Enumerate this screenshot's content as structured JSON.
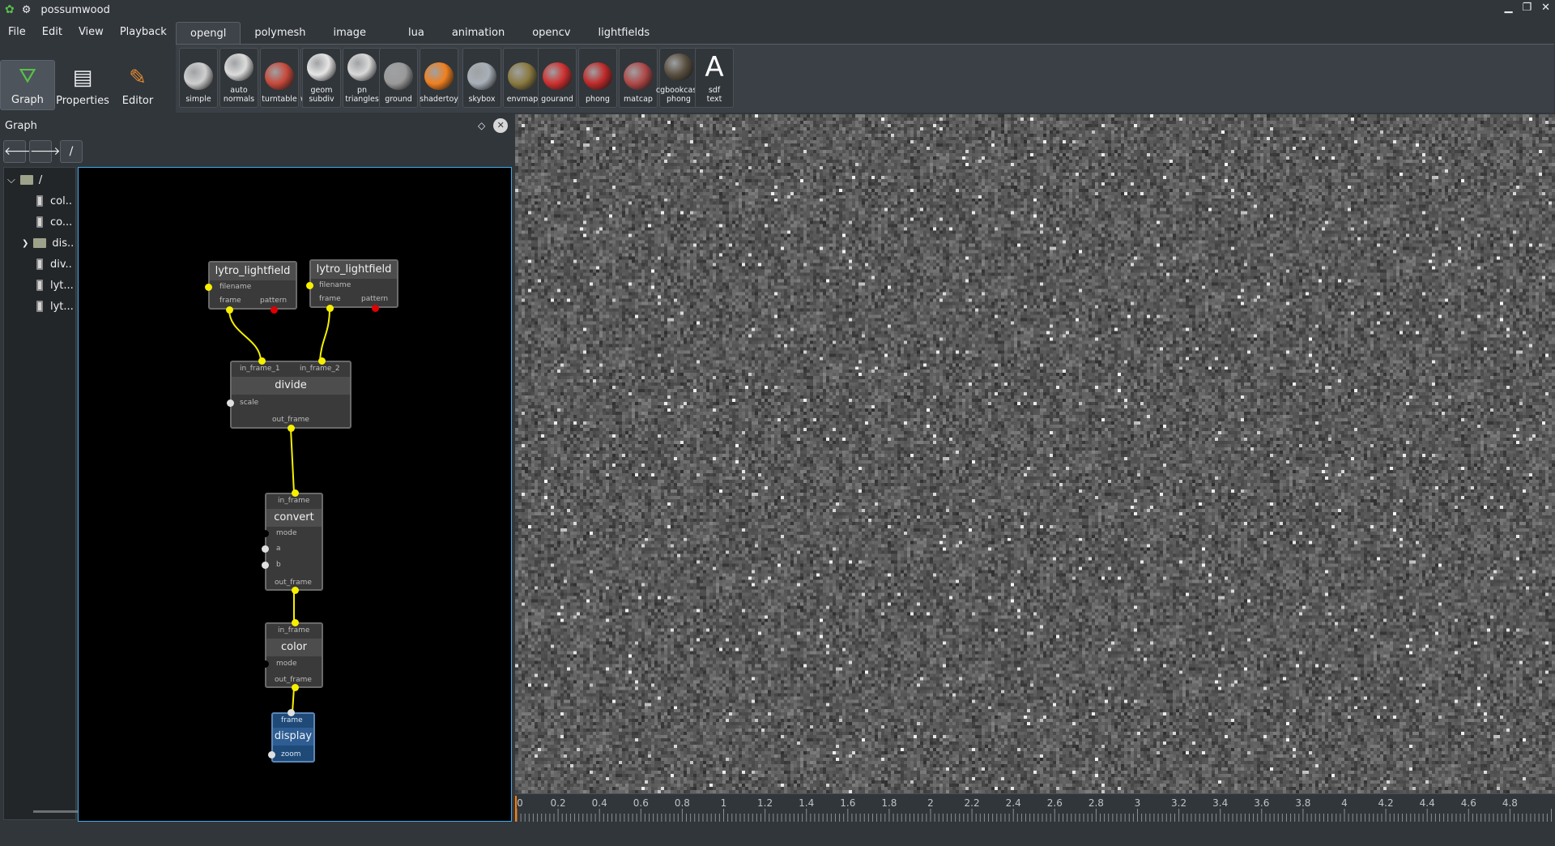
{
  "window": {
    "title": "possumwood",
    "controls": [
      "▁",
      "❐",
      "✕"
    ]
  },
  "menu": [
    "File",
    "Edit",
    "View",
    "Playback"
  ],
  "modes": [
    {
      "label": "Graph",
      "icon": "graph-icon"
    },
    {
      "label": "Properties",
      "icon": "properties-icon"
    },
    {
      "label": "Editor",
      "icon": "editor-icon"
    }
  ],
  "tabs": [
    "opengl",
    "polymesh",
    "image",
    "lua",
    "animation",
    "opencv",
    "lightfields"
  ],
  "active_tab": "opengl",
  "tools": [
    {
      "label": "simple",
      "icon": "teapot-icon",
      "color": "#cfcfcf"
    },
    {
      "label": "auto\nnormals",
      "icon": "teapot-icon",
      "color": "#dcdcdc"
    },
    {
      "label": "turntable",
      "icon": "car-icon",
      "color": "#c84a3c"
    },
    {
      "label": "wireframe",
      "icon": "wire-cube-icon",
      "color": "#8a8a8a"
    },
    {
      "label": "geom\nsubdiv",
      "icon": "shell-icon",
      "color": "#e6e6e6"
    },
    {
      "label": "pn\ntriangles",
      "icon": "cone-icon",
      "color": "#d9d9d9"
    },
    {
      "label": "ground",
      "icon": "ground-icon",
      "color": "#9a9a9a"
    },
    {
      "label": "shadertoy",
      "icon": "swirl-icon",
      "color": "#f08020"
    },
    {
      "label": "skybox",
      "icon": "sphere-icon",
      "color": "#a8b0b8"
    },
    {
      "label": "envmap",
      "icon": "teapot-icon",
      "color": "#8a7a40"
    },
    {
      "label": "gourand",
      "icon": "teapot-icon",
      "color": "#d03030"
    },
    {
      "label": "phong",
      "icon": "teapot-icon",
      "color": "#c02a2a"
    },
    {
      "label": "matcap",
      "icon": "figure-icon",
      "color": "#b04848"
    },
    {
      "label": "cgbookcase\nphong",
      "icon": "sphere-icon",
      "color": "#5a5040"
    },
    {
      "label": "sdf\ntext",
      "icon": "letter-a-icon",
      "color": "#ffffff",
      "glyph": "A"
    }
  ],
  "panel": {
    "title": "Graph",
    "path": "/",
    "back": "🡐",
    "forward": "🡒",
    "float": "◇",
    "close": "✕"
  },
  "tree": {
    "root": "/",
    "items": [
      {
        "label": "col..",
        "type": "file"
      },
      {
        "label": "co...",
        "type": "file"
      },
      {
        "label": "dis..",
        "type": "folder",
        "expandable": true
      },
      {
        "label": "div..",
        "type": "file"
      },
      {
        "label": "lyt...",
        "type": "file"
      },
      {
        "label": "lyt...",
        "type": "file"
      }
    ]
  },
  "nodes": {
    "lytro1": {
      "title": "lytro_lightfield",
      "ports": [
        "filename",
        "frame",
        "pattern"
      ]
    },
    "lytro2": {
      "title": "lytro_lightfield",
      "ports": [
        "filename",
        "frame",
        "pattern"
      ]
    },
    "divide": {
      "title": "divide",
      "ports": [
        "in_frame_1",
        "in_frame_2",
        "scale",
        "out_frame"
      ]
    },
    "convert": {
      "title": "convert",
      "ports": [
        "in_frame",
        "mode",
        "a",
        "b",
        "out_frame"
      ]
    },
    "color": {
      "title": "color",
      "ports": [
        "in_frame",
        "mode",
        "out_frame"
      ]
    },
    "display": {
      "title": "display",
      "ports": [
        "frame",
        "zoom"
      ]
    }
  },
  "timeline": {
    "ticks": [
      "0",
      "0.2",
      "0.4",
      "0.6",
      "0.8",
      "1",
      "1.2",
      "1.4",
      "1.6",
      "1.8",
      "2",
      "2.2",
      "2.4",
      "2.6",
      "2.8",
      "3",
      "3.2",
      "3.4",
      "3.6",
      "3.8",
      "4",
      "4.2",
      "4.4",
      "4.6",
      "4.8"
    ]
  }
}
